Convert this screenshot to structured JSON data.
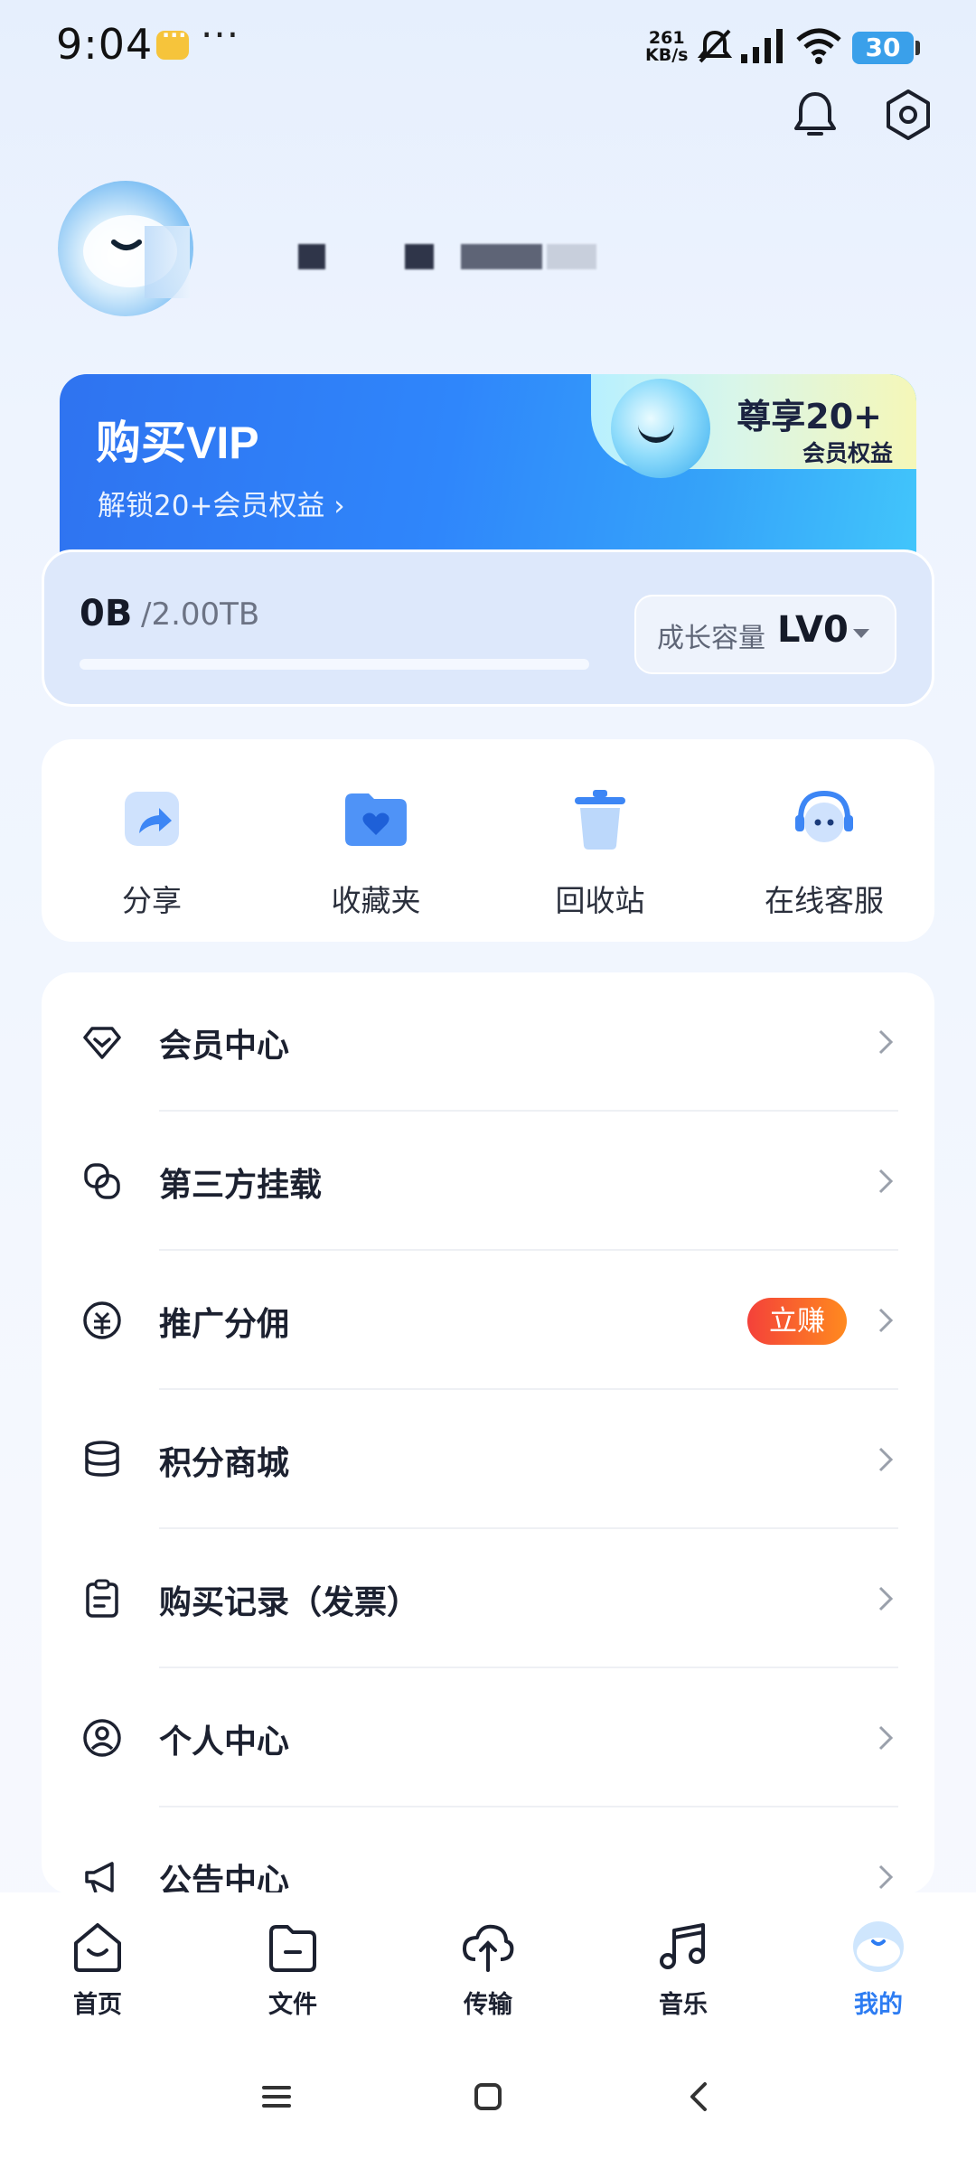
{
  "status_bar": {
    "time": "9:04",
    "speed_value": "261",
    "speed_unit": "KB/s",
    "battery": "30",
    "more": "···"
  },
  "header": {
    "bell_icon": "bell-icon",
    "settings_icon": "settings-icon"
  },
  "profile": {
    "avatar_icon": "cloud-mascot-avatar"
  },
  "vip_banner": {
    "title": "购买VIP",
    "subtitle": "解锁20+会员权益 ›",
    "tag_main": "尊享20+",
    "tag_sub": "会员权益"
  },
  "storage": {
    "used": "0B",
    "total": "/2.00TB",
    "used_fraction": 0.0,
    "level_label": "成长容量",
    "level_value": "LV0"
  },
  "tools": [
    {
      "label": "分享",
      "icon": "share-icon"
    },
    {
      "label": "收藏夹",
      "icon": "favorites-folder-icon"
    },
    {
      "label": "回收站",
      "icon": "recycle-bin-icon"
    },
    {
      "label": "在线客服",
      "icon": "customer-service-icon"
    }
  ],
  "menu": [
    {
      "label": "会员中心",
      "icon": "diamond-icon"
    },
    {
      "label": "第三方挂载",
      "icon": "link-icon"
    },
    {
      "label": "推广分佣",
      "icon": "coin-icon",
      "badge": "立赚"
    },
    {
      "label": "积分商城",
      "icon": "coins-stack-icon"
    },
    {
      "label": "购买记录（发票）",
      "icon": "clipboard-icon"
    },
    {
      "label": "个人中心",
      "icon": "user-circle-icon"
    },
    {
      "label": "公告中心",
      "icon": "megaphone-icon"
    }
  ],
  "bottom_nav": [
    {
      "label": "首页",
      "icon": "home-icon",
      "active": false
    },
    {
      "label": "文件",
      "icon": "folder-icon",
      "active": false
    },
    {
      "label": "传输",
      "icon": "cloud-transfer-icon",
      "active": false
    },
    {
      "label": "音乐",
      "icon": "music-icon",
      "active": false
    },
    {
      "label": "我的",
      "icon": "profile-mascot-icon",
      "active": true
    }
  ],
  "colors": {
    "accent": "#2d7cf2",
    "badge_start": "#f4413a",
    "badge_end": "#ff8a1f",
    "text": "#1c2130"
  }
}
